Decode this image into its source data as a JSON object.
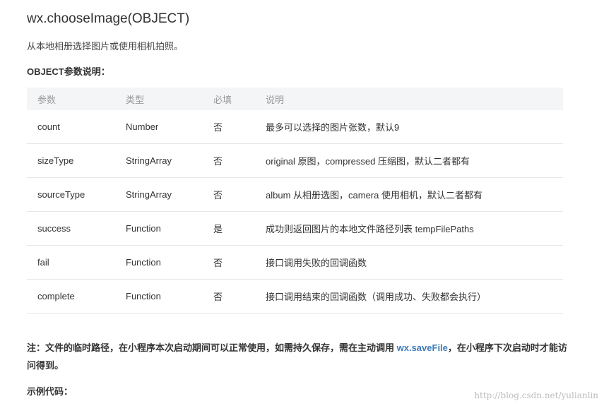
{
  "title": "wx.chooseImage(OBJECT)",
  "description": "从本地相册选择图片或使用相机拍照。",
  "params_heading": "OBJECT参数说明：",
  "table": {
    "headers": [
      "参数",
      "类型",
      "必填",
      "说明"
    ],
    "rows": [
      {
        "name": "count",
        "type": "Number",
        "required": "否",
        "desc": "最多可以选择的图片张数，默认9"
      },
      {
        "name": "sizeType",
        "type": "StringArray",
        "required": "否",
        "desc": "original 原图，compressed 压缩图，默认二者都有"
      },
      {
        "name": "sourceType",
        "type": "StringArray",
        "required": "否",
        "desc": "album 从相册选图，camera 使用相机，默认二者都有"
      },
      {
        "name": "success",
        "type": "Function",
        "required": "是",
        "desc": "成功则返回图片的本地文件路径列表 tempFilePaths"
      },
      {
        "name": "fail",
        "type": "Function",
        "required": "否",
        "desc": "接口调用失败的回调函数"
      },
      {
        "name": "complete",
        "type": "Function",
        "required": "否",
        "desc": "接口调用结束的回调函数（调用成功、失败都会执行）"
      }
    ]
  },
  "note": {
    "before": "注：文件的临时路径，在小程序本次启动期间可以正常使用，如需持久保存，需在主动调用 ",
    "link": "wx.saveFile",
    "after": "，在小程序下次启动时才能访问得到。"
  },
  "example_heading": "示例代码：",
  "watermark": "http://blog.csdn.net/yulianlin"
}
